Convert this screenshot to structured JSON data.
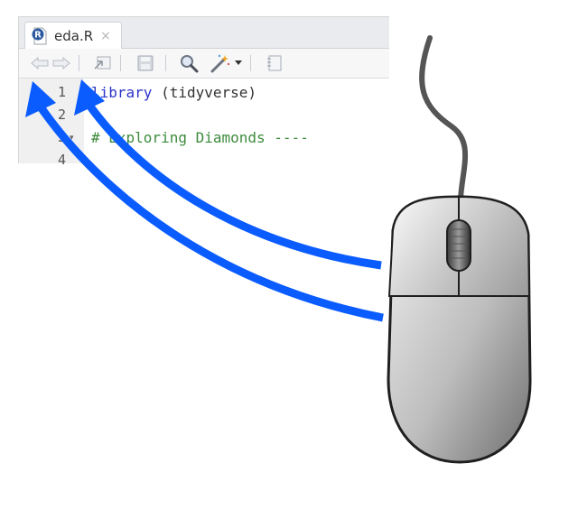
{
  "editor": {
    "tab": {
      "filename": "eda.R",
      "close_glyph": "×",
      "file_icon": "r-file-icon",
      "file_icon_letter": "R"
    },
    "toolbar": {
      "icons": [
        "back-arrow-icon",
        "forward-arrow-icon",
        "show-in-window-icon",
        "save-icon",
        "search-icon",
        "magic-wand-icon",
        "dropdown-caret-icon",
        "notebook-icon"
      ]
    },
    "lines": [
      {
        "number": "1",
        "fold": "",
        "parts": [
          {
            "text": "library",
            "cls": "kw"
          },
          {
            "text": " (tidyverse)",
            "cls": "txt"
          }
        ]
      },
      {
        "number": "2",
        "fold": "",
        "parts": []
      },
      {
        "number": "3",
        "fold": "▾",
        "parts": [
          {
            "text": "# Exploring Diamonds ----",
            "cls": "cm"
          }
        ]
      },
      {
        "number": "4",
        "fold": "",
        "parts": []
      }
    ]
  },
  "annotation": {
    "arrow_color": "#0a5cff",
    "arrows": [
      "arrow-mouse-to-back",
      "arrow-mouse-to-forward"
    ],
    "device": "computer-mouse-illustration"
  }
}
